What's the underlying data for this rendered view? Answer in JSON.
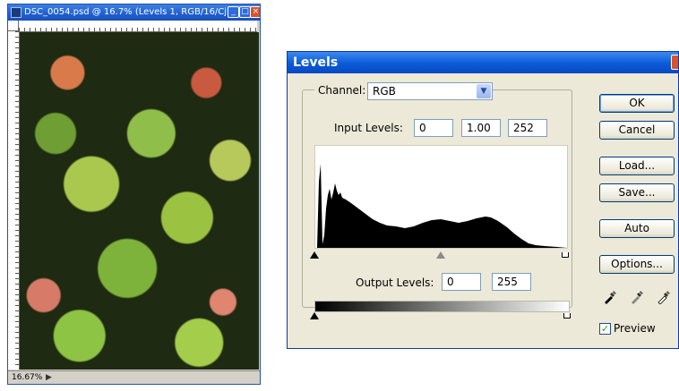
{
  "document_window": {
    "title": "DSC_0054.psd @ 16.7% (Levels 1, RGB/16/CjK...",
    "zoom": "16.67%",
    "status_arrow": "▶"
  },
  "levels_dialog": {
    "title": "Levels",
    "channel_label": "Channel:",
    "channel_value": "RGB",
    "input_levels_label": "Input Levels:",
    "input_black": "0",
    "input_gamma": "1.00",
    "input_white": "252",
    "output_levels_label": "Output Levels:",
    "output_black": "0",
    "output_white": "255",
    "buttons": {
      "ok": "OK",
      "cancel": "Cancel",
      "load": "Load...",
      "save": "Save...",
      "auto": "Auto",
      "options": "Options..."
    },
    "preview_label": "Preview",
    "preview_checked": true
  },
  "colors": {
    "dialog_bg": "#ece9d8",
    "titlebar_blue": "#0a5bd8",
    "close_red": "#d9532a"
  },
  "icons": [
    "app-icon",
    "minimize-icon",
    "maximize-icon",
    "close-icon",
    "dropdown-arrow-icon",
    "black-eyedropper-icon",
    "gray-eyedropper-icon",
    "white-eyedropper-icon",
    "checkmark-icon"
  ]
}
